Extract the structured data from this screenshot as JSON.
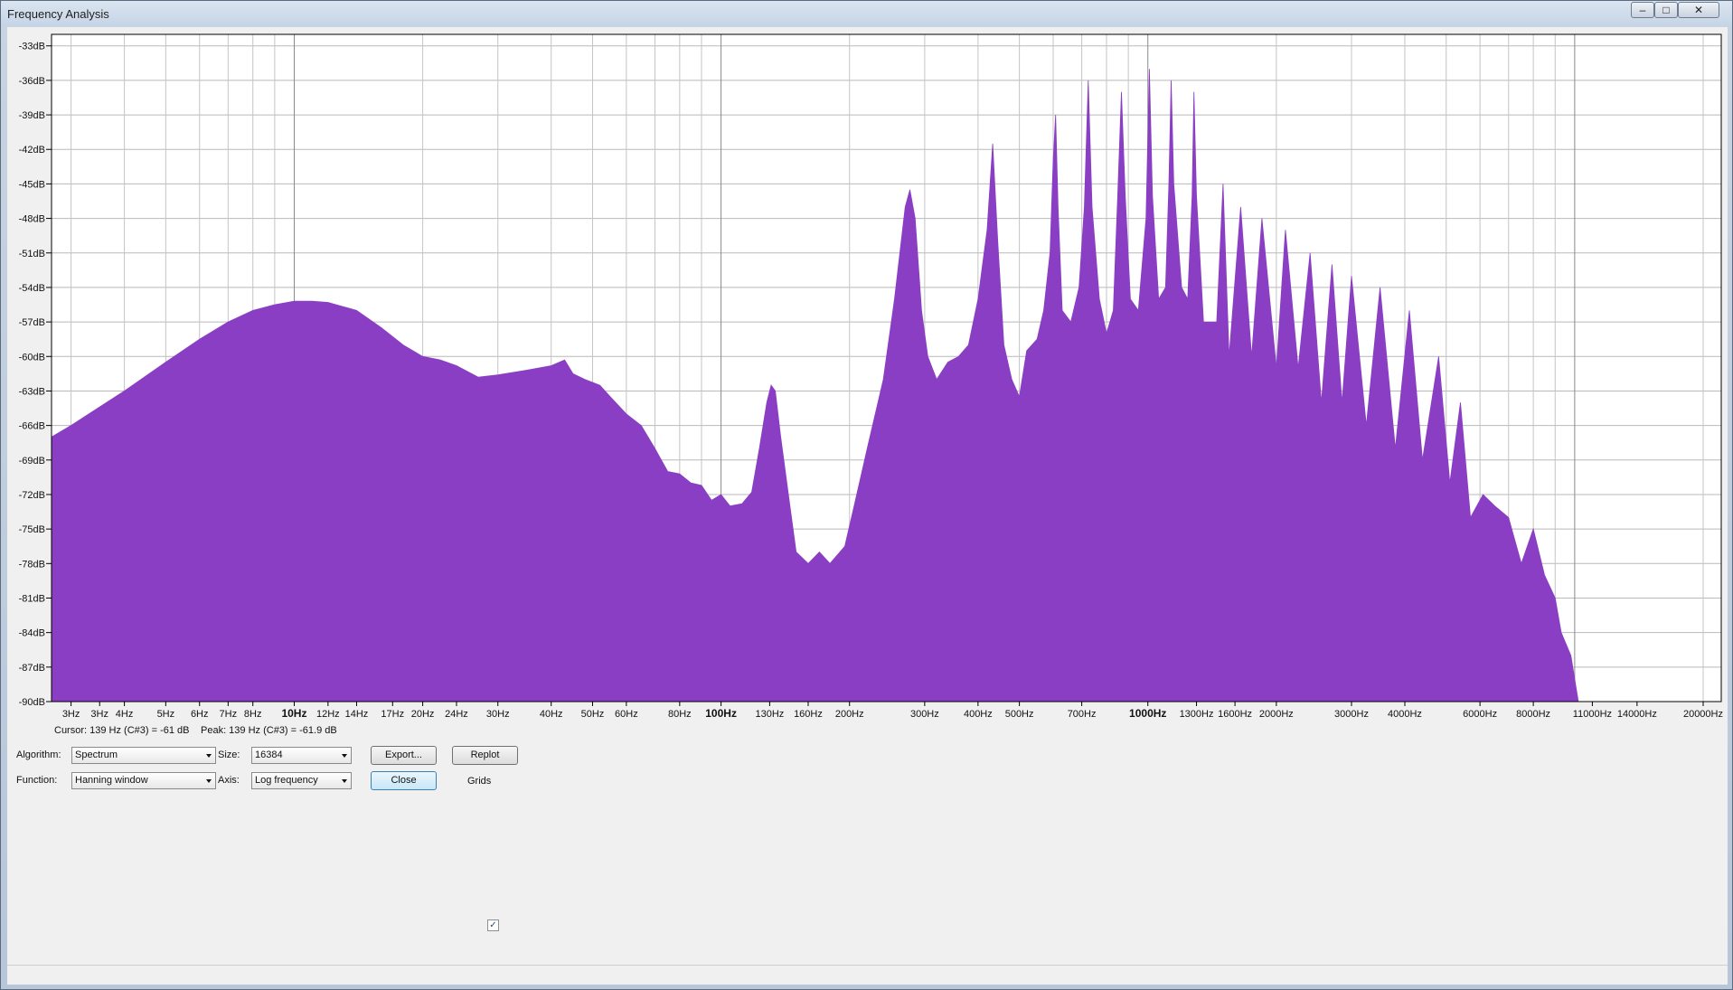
{
  "window": {
    "title": "Frequency Analysis",
    "minimize_glyph": "‒",
    "maximize_glyph": "□",
    "close_glyph": "✕"
  },
  "chart_data": {
    "type": "area",
    "xscale": "log",
    "xlim": [
      2.7,
      22050
    ],
    "ylim": [
      -90,
      -32
    ],
    "fill_color": "#8a3ec3",
    "grid": true,
    "y_ticks": [
      "-33dB",
      "-36dB",
      "-39dB",
      "-42dB",
      "-45dB",
      "-48dB",
      "-51dB",
      "-54dB",
      "-57dB",
      "-60dB",
      "-63dB",
      "-66dB",
      "-69dB",
      "-72dB",
      "-75dB",
      "-78dB",
      "-81dB",
      "-84dB",
      "-87dB",
      "-90dB"
    ],
    "y_tick_values": [
      -33,
      -36,
      -39,
      -42,
      -45,
      -48,
      -51,
      -54,
      -57,
      -60,
      -63,
      -66,
      -69,
      -72,
      -75,
      -78,
      -81,
      -84,
      -87,
      -90
    ],
    "x_ticks": [
      {
        "value": 3,
        "label": "3Hz"
      },
      {
        "value": 3.5,
        "label": "3Hz"
      },
      {
        "value": 4,
        "label": "4Hz"
      },
      {
        "value": 5,
        "label": "5Hz"
      },
      {
        "value": 6,
        "label": "6Hz"
      },
      {
        "value": 7,
        "label": "7Hz"
      },
      {
        "value": 8,
        "label": "8Hz"
      },
      {
        "value": 10,
        "label": "10Hz",
        "bold": true
      },
      {
        "value": 12,
        "label": "12Hz"
      },
      {
        "value": 14,
        "label": "14Hz"
      },
      {
        "value": 17,
        "label": "17Hz"
      },
      {
        "value": 20,
        "label": "20Hz"
      },
      {
        "value": 24,
        "label": "24Hz"
      },
      {
        "value": 30,
        "label": "30Hz"
      },
      {
        "value": 40,
        "label": "40Hz"
      },
      {
        "value": 50,
        "label": "50Hz"
      },
      {
        "value": 60,
        "label": "60Hz"
      },
      {
        "value": 80,
        "label": "80Hz"
      },
      {
        "value": 100,
        "label": "100Hz",
        "bold": true
      },
      {
        "value": 130,
        "label": "130Hz"
      },
      {
        "value": 160,
        "label": "160Hz"
      },
      {
        "value": 200,
        "label": "200Hz"
      },
      {
        "value": 300,
        "label": "300Hz"
      },
      {
        "value": 400,
        "label": "400Hz"
      },
      {
        "value": 500,
        "label": "500Hz"
      },
      {
        "value": 700,
        "label": "700Hz"
      },
      {
        "value": 1000,
        "label": "1000Hz",
        "bold": true
      },
      {
        "value": 1300,
        "label": "1300Hz"
      },
      {
        "value": 1600,
        "label": "1600Hz"
      },
      {
        "value": 2000,
        "label": "2000Hz"
      },
      {
        "value": 3000,
        "label": "3000Hz"
      },
      {
        "value": 4000,
        "label": "4000Hz"
      },
      {
        "value": 6000,
        "label": "6000Hz"
      },
      {
        "value": 8000,
        "label": "8000Hz"
      },
      {
        "value": 11000,
        "label": "11000Hz"
      },
      {
        "value": 14000,
        "label": "14000Hz"
      },
      {
        "value": 20000,
        "label": "20000Hz"
      }
    ],
    "envelope": [
      [
        2.7,
        -67
      ],
      [
        3,
        -66
      ],
      [
        4,
        -63
      ],
      [
        5,
        -60.5
      ],
      [
        6,
        -58.5
      ],
      [
        7,
        -57
      ],
      [
        8,
        -56
      ],
      [
        9,
        -55.5
      ],
      [
        10,
        -55.2
      ],
      [
        11,
        -55.2
      ],
      [
        12,
        -55.3
      ],
      [
        14,
        -56
      ],
      [
        16,
        -57.5
      ],
      [
        18,
        -59
      ],
      [
        20,
        -60
      ],
      [
        22,
        -60.3
      ],
      [
        24,
        -60.8
      ],
      [
        27,
        -61.8
      ],
      [
        30,
        -61.6
      ],
      [
        35,
        -61.2
      ],
      [
        40,
        -60.8
      ],
      [
        43,
        -60.3
      ],
      [
        45,
        -61.5
      ],
      [
        48,
        -62
      ],
      [
        52,
        -62.5
      ],
      [
        55,
        -63.5
      ],
      [
        60,
        -65
      ],
      [
        65,
        -66
      ],
      [
        70,
        -68
      ],
      [
        75,
        -70
      ],
      [
        80,
        -70.2
      ],
      [
        85,
        -71
      ],
      [
        90,
        -71.2
      ],
      [
        95,
        -72.5
      ],
      [
        100,
        -72
      ],
      [
        105,
        -73
      ],
      [
        112,
        -72.8
      ],
      [
        118,
        -71.8
      ],
      [
        123,
        -68
      ],
      [
        128,
        -64
      ],
      [
        131,
        -62.5
      ],
      [
        134,
        -63
      ],
      [
        138,
        -67
      ],
      [
        145,
        -73
      ],
      [
        150,
        -77
      ],
      [
        160,
        -78
      ],
      [
        170,
        -77
      ],
      [
        180,
        -78
      ],
      [
        195,
        -76.5
      ],
      [
        205,
        -73
      ],
      [
        220,
        -68
      ],
      [
        240,
        -62
      ],
      [
        255,
        -55
      ],
      [
        270,
        -47
      ],
      [
        277,
        -45.5
      ],
      [
        285,
        -48
      ],
      [
        295,
        -56
      ],
      [
        305,
        -60
      ],
      [
        320,
        -62
      ],
      [
        340,
        -60.5
      ],
      [
        360,
        -60
      ],
      [
        380,
        -59
      ],
      [
        400,
        -55
      ],
      [
        420,
        -49
      ],
      [
        433,
        -41.5
      ],
      [
        445,
        -50
      ],
      [
        460,
        -59
      ],
      [
        480,
        -62
      ],
      [
        500,
        -63.5
      ],
      [
        520,
        -59.5
      ],
      [
        550,
        -58.5
      ],
      [
        570,
        -56
      ],
      [
        590,
        -51
      ],
      [
        600,
        -43
      ],
      [
        608,
        -39
      ],
      [
        616,
        -47
      ],
      [
        630,
        -56
      ],
      [
        660,
        -57
      ],
      [
        690,
        -54
      ],
      [
        710,
        -47
      ],
      [
        725,
        -36
      ],
      [
        740,
        -47
      ],
      [
        770,
        -55
      ],
      [
        800,
        -58
      ],
      [
        830,
        -56
      ],
      [
        850,
        -46
      ],
      [
        867,
        -37
      ],
      [
        885,
        -46
      ],
      [
        910,
        -55
      ],
      [
        950,
        -56
      ],
      [
        990,
        -48
      ],
      [
        1008,
        -35
      ],
      [
        1025,
        -46
      ],
      [
        1060,
        -55
      ],
      [
        1100,
        -54
      ],
      [
        1120,
        -45
      ],
      [
        1134,
        -36
      ],
      [
        1150,
        -45
      ],
      [
        1200,
        -54
      ],
      [
        1240,
        -55
      ],
      [
        1270,
        -46
      ],
      [
        1282,
        -37
      ],
      [
        1300,
        -46
      ],
      [
        1350,
        -57
      ],
      [
        1450,
        -57
      ],
      [
        1500,
        -45
      ],
      [
        1550,
        -60
      ],
      [
        1650,
        -47
      ],
      [
        1750,
        -60
      ],
      [
        1850,
        -48
      ],
      [
        2000,
        -61
      ],
      [
        2100,
        -49
      ],
      [
        2250,
        -61
      ],
      [
        2400,
        -51
      ],
      [
        2550,
        -64
      ],
      [
        2700,
        -52
      ],
      [
        2850,
        -64
      ],
      [
        3000,
        -53
      ],
      [
        3250,
        -66
      ],
      [
        3500,
        -54
      ],
      [
        3800,
        -68
      ],
      [
        4100,
        -56
      ],
      [
        4400,
        -69
      ],
      [
        4800,
        -60
      ],
      [
        5100,
        -71
      ],
      [
        5400,
        -64
      ],
      [
        5700,
        -74
      ],
      [
        6100,
        -72
      ],
      [
        6500,
        -73
      ],
      [
        7000,
        -74
      ],
      [
        7500,
        -78
      ],
      [
        8000,
        -75
      ],
      [
        8500,
        -79
      ],
      [
        9000,
        -81
      ],
      [
        9300,
        -84
      ],
      [
        9800,
        -86
      ],
      [
        10200,
        -90
      ],
      [
        10500,
        -90
      ]
    ]
  },
  "readout": {
    "cursor": "Cursor: 139 Hz (C#3) = -61 dB",
    "peak": "Peak: 139 Hz (C#3) = -61.9 dB"
  },
  "controls": {
    "algorithm_label": "Algorithm:",
    "algorithm_value": "Spectrum",
    "size_label": "Size:",
    "size_value": "16384",
    "export_label": "Export...",
    "replot_label": "Replot",
    "function_label": "Function:",
    "function_value": "Hanning window",
    "axis_label": "Axis:",
    "axis_value": "Log frequency",
    "close_label": "Close",
    "grids_label": "Grids",
    "grids_checked": true,
    "check_glyph": "✓"
  }
}
